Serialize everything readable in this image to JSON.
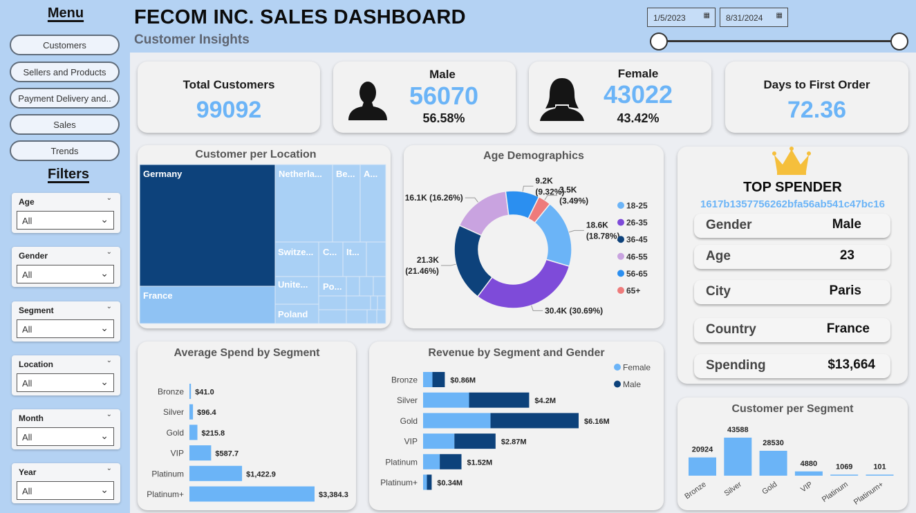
{
  "title": "FECOM INC. SALES DASHBOARD",
  "subtitle": "Customer Insights",
  "date_range": {
    "start": "1/5/2023",
    "end": "8/31/2024"
  },
  "menu": {
    "heading": "Menu",
    "items": [
      "Customers",
      "Sellers and Products",
      "Payment Delivery and..",
      "Sales",
      "Trends"
    ]
  },
  "filters": {
    "heading": "Filters",
    "items": [
      {
        "label": "Age",
        "value": "All"
      },
      {
        "label": "Gender",
        "value": "All"
      },
      {
        "label": "Segment",
        "value": "All"
      },
      {
        "label": "Location",
        "value": "All"
      },
      {
        "label": "Month",
        "value": "All"
      },
      {
        "label": "Year",
        "value": "All"
      }
    ]
  },
  "kpis": {
    "total_customers": {
      "label": "Total Customers",
      "value": "99092"
    },
    "male": {
      "label": "Male",
      "value": "56070",
      "pct": "56.58%"
    },
    "female": {
      "label": "Female",
      "value": "43022",
      "pct": "43.42%"
    },
    "days_first_order": {
      "label": "Days to First Order",
      "value": "72.36"
    }
  },
  "top_spender": {
    "title": "TOP SPENDER",
    "id": "1617b1357756262bfa56ab541c47bc16",
    "rows": [
      {
        "key": "Gender",
        "value": "Male"
      },
      {
        "key": "Age",
        "value": "23"
      },
      {
        "key": "City",
        "value": "Paris"
      },
      {
        "key": "Country",
        "value": "France"
      },
      {
        "key": "Spending",
        "value": "$13,664"
      }
    ]
  },
  "colors": {
    "light": "#6bb4f7",
    "dark": "#0d427b",
    "purple": "#7e4bd9",
    "lavender": "#c9a3e0",
    "blue": "#2b8ff0",
    "red": "#ee7b7b",
    "kpi": "#6bb4f7"
  },
  "chart_data": [
    {
      "type": "treemap",
      "title": "Customer per Location",
      "labels": [
        "Germany",
        "France",
        "Netherla...",
        "Be...",
        "A...",
        "Switze...",
        "C...",
        "It...",
        "Unite...",
        "Po...",
        "Poland"
      ]
    },
    {
      "type": "pie",
      "title": "Age Demographics",
      "categories": [
        "18-25",
        "26-35",
        "36-45",
        "46-55",
        "56-65",
        "65+"
      ],
      "values": [
        18.6,
        30.4,
        21.3,
        16.1,
        9.2,
        3.5
      ],
      "percents": [
        18.78,
        30.69,
        21.46,
        16.26,
        9.32,
        3.49
      ],
      "labels": [
        "18.6K\n(18.78%)",
        "30.4K (30.69%)",
        "21.3K\n(21.46%)",
        "16.1K (16.26%)",
        "9.2K\n(9.32%)",
        "3.5K\n(3.49%)"
      ],
      "colors": [
        "#6bb4f7",
        "#7e4bd9",
        "#0d427b",
        "#c9a3e0",
        "#2b8ff0",
        "#ee7b7b"
      ],
      "legend": "right"
    },
    {
      "type": "bar",
      "orientation": "horizontal",
      "title": "Average Spend by Segment",
      "categories": [
        "Bronze",
        "Silver",
        "Gold",
        "VIP",
        "Platinum",
        "Platinum+"
      ],
      "values": [
        41.0,
        96.4,
        215.8,
        587.7,
        1422.9,
        3384.3
      ],
      "labels": [
        "$41.0",
        "$96.4",
        "$215.8",
        "$587.7",
        "$1,422.9",
        "$3,384.3"
      ]
    },
    {
      "type": "bar",
      "orientation": "horizontal",
      "stacked": true,
      "title": "Revenue by Segment and Gender",
      "categories": [
        "Bronze",
        "Silver",
        "Gold",
        "VIP",
        "Platinum",
        "Platinum+"
      ],
      "series": [
        {
          "name": "Female",
          "values": [
            0.37,
            1.82,
            2.67,
            1.24,
            0.66,
            0.15
          ]
        },
        {
          "name": "Male",
          "values": [
            0.49,
            2.38,
            3.49,
            1.63,
            0.86,
            0.19
          ]
        }
      ],
      "totals": [
        "$0.86M",
        "$4.2M",
        "$6.16M",
        "$2.87M",
        "$1.52M",
        "$0.34M"
      ],
      "legend": "top-right"
    },
    {
      "type": "bar",
      "title": "Customer per Segment",
      "categories": [
        "Bronze",
        "Silver",
        "Gold",
        "VIP",
        "Platinum",
        "Platinum+"
      ],
      "values": [
        20924,
        43588,
        28530,
        4880,
        1069,
        101
      ]
    }
  ]
}
